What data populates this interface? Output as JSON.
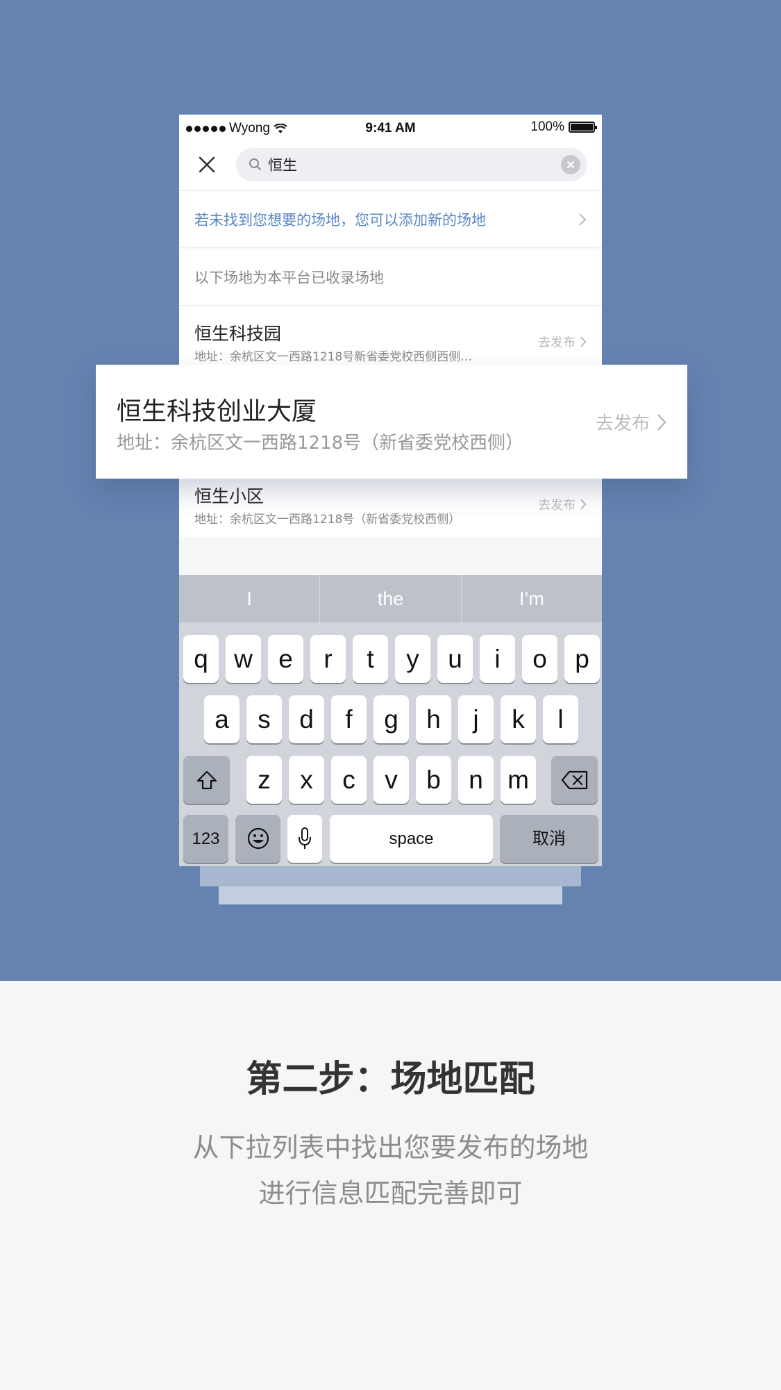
{
  "status": {
    "carrier": "Wyong",
    "time": "9:41 AM",
    "battery": "100%"
  },
  "search": {
    "query": "恒生"
  },
  "hint": {
    "text": "若未找到您想要的场地，您可以添加新的场地"
  },
  "platform_note": "以下场地为本平台已收录场地",
  "venues": [
    {
      "name": "恒生科技园",
      "address": "地址：余杭区文一西路1218号新省委党校西侧西侧…",
      "action": "去发布"
    },
    {
      "name": "恒生科技创业大厦",
      "address": "地址：余杭区文一西路1218号（新省委党校西侧）",
      "action": "去发布"
    },
    {
      "name": "恒生小区",
      "address": "地址：余杭区文一西路1218号（新省委党校西侧）",
      "action": "去发布"
    }
  ],
  "keyboard": {
    "predictions": [
      "I",
      "the",
      "I’m"
    ],
    "row1": [
      "q",
      "w",
      "e",
      "r",
      "t",
      "y",
      "u",
      "i",
      "o",
      "p"
    ],
    "row2": [
      "a",
      "s",
      "d",
      "f",
      "g",
      "h",
      "j",
      "k",
      "l"
    ],
    "row3": [
      "z",
      "x",
      "c",
      "v",
      "b",
      "n",
      "m"
    ],
    "numbers_key": "123",
    "space_key": "space",
    "cancel_key": "取消"
  },
  "caption": {
    "title": "第二步：场地匹配",
    "line1": "从下拉列表中找出您要发布的场地",
    "line2": "进行信息匹配完善即可"
  },
  "colors": {
    "hero_bg": "#6483b1",
    "link_blue": "#5a87c4"
  }
}
